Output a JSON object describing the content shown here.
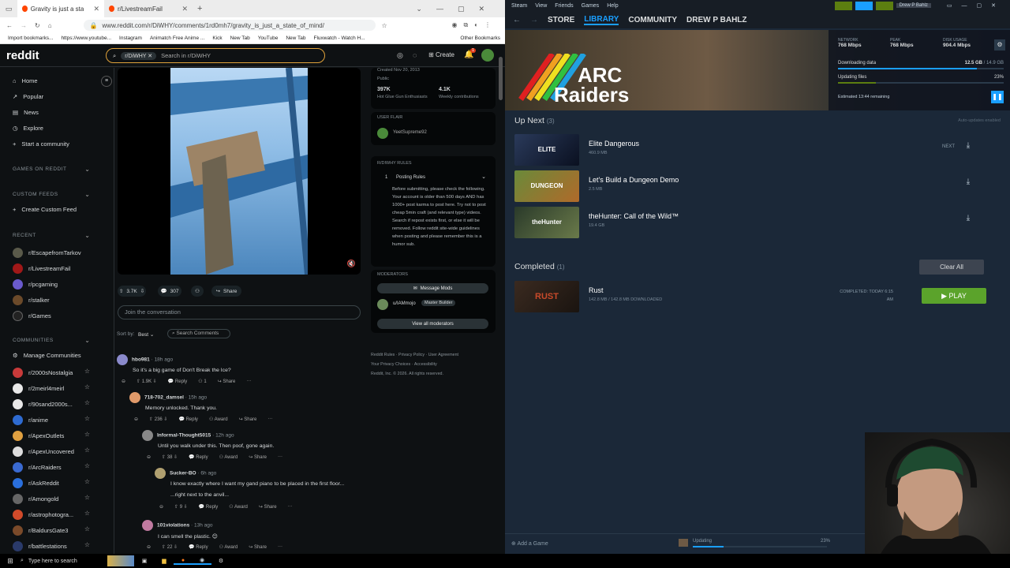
{
  "browser": {
    "tabs": [
      {
        "label": "Gravity is just a state of mind..."
      },
      {
        "label": "r/LivestreamFail"
      }
    ],
    "url": "www.reddit.com/r/DiWHY/comments/1rd0mh7/gravity_is_just_a_state_of_mind/",
    "bookmarks": [
      "Import bookmarks...",
      "https://www.youtube...",
      "Instagram",
      "Animatch Free Anime ...",
      "Kick",
      "New Tab",
      "YouTube",
      "New Tab",
      "Fluxwatch - Watch H...",
      "Other Bookmarks"
    ]
  },
  "reddit": {
    "logo": "reddit",
    "search_chip": "r/DiWHY",
    "search_placeholder": "Search in r/DiWHY",
    "create_label": "Create",
    "notif_count": "1",
    "sidebar": {
      "top": [
        {
          "label": "Home"
        },
        {
          "label": "Popular"
        },
        {
          "label": "News"
        },
        {
          "label": "Explore"
        },
        {
          "label": "Start a community"
        }
      ],
      "games_header": "GAMES ON REDDIT",
      "feeds_header": "CUSTOM FEEDS",
      "create_feed": "Create Custom Feed",
      "recent_header": "RECENT",
      "recent": [
        {
          "label": "r/EscapefromTarkov",
          "color": "#5a5a4a"
        },
        {
          "label": "r/LivestreamFail",
          "color": "#a01818"
        },
        {
          "label": "r/pcgaming",
          "color": "#6a5acd"
        },
        {
          "label": "r/stalker",
          "color": "#6b4a2a"
        },
        {
          "label": "r/Games",
          "color": "#222222"
        }
      ],
      "communities_header": "COMMUNITIES",
      "manage": "Manage Communities",
      "communities": [
        {
          "label": "r/2000sNostalgia",
          "color": "#c83a3a"
        },
        {
          "label": "r/2meirl4meirl",
          "color": "#e8e8e8"
        },
        {
          "label": "r/90sand2000s...",
          "color": "#e8e8e8"
        },
        {
          "label": "r/anime",
          "color": "#2e6bd1"
        },
        {
          "label": "r/ApexOutlets",
          "color": "#e0a040"
        },
        {
          "label": "r/ApexUncovered",
          "color": "#dddddd"
        },
        {
          "label": "r/ArcRaiders",
          "color": "#3a6ad1"
        },
        {
          "label": "r/AskReddit",
          "color": "#2a6fdc"
        },
        {
          "label": "r/Amongold",
          "color": "#666666"
        },
        {
          "label": "r/astrophotogra...",
          "color": "#d14a2a"
        },
        {
          "label": "r/BaldursGate3",
          "color": "#7a4a2a"
        },
        {
          "label": "r/battlestations",
          "color": "#2a3a6a"
        }
      ]
    },
    "post_actions": {
      "votes": "3.7K",
      "comments": "307",
      "share": "Share"
    },
    "join_placeholder": "Join the conversation",
    "sort_label": "Sort by:",
    "sort_value": "Best",
    "search_comments": "Search Comments",
    "comments": [
      {
        "user": "hbo981",
        "time": "18h ago",
        "text": "So it's a big game of Don't Break the Ice?",
        "votes": "1.9K",
        "reply": "Reply",
        "award": "1",
        "share": "Share"
      },
      {
        "user": "718-702_damsel",
        "time": "15h ago",
        "text": "Memory unlocked. Thank you.",
        "votes": "236",
        "reply": "Reply",
        "award": "Award",
        "share": "Share"
      },
      {
        "user": "Informal-Thought5015",
        "time": "12h ago",
        "text": "Until you walk under this. Then poof, gone again.",
        "votes": "38",
        "reply": "Reply",
        "award": "Award",
        "share": "Share"
      },
      {
        "user": "Sucker-BO",
        "time": "6h ago",
        "text": "I know exactly where I want my gand piano to be placed in the first floor...",
        "text2": "...right next to the anvil...",
        "votes": "9",
        "reply": "Reply",
        "award": "Award",
        "share": "Share"
      },
      {
        "user": "101violations",
        "time": "13h ago",
        "text": "I can smell the plastic. 😊",
        "votes": "22",
        "reply": "Reply",
        "award": "Award",
        "share": "Share"
      }
    ],
    "community_card": {
      "created": "Created Nov 20, 2013",
      "visibility": "Public",
      "members": "397K",
      "members_label": "Hot Glue Gun Enthusiasts",
      "weekly": "4.1K",
      "weekly_label": "Weekly contributions"
    },
    "user_flair_header": "USER FLAIR",
    "user_flair_name": "YeetSupreme92",
    "rules_header": "R/DIWHY RULES",
    "rule_num": "1",
    "rule_title": "Posting Rules",
    "rule_text": "Before submitting, please check the following. Your account is older than 500 days AND has 1000+ post karma to post here. Try not to post cheap 5min craft (and relevant type) videos. Search if repost exists first, or else it will be removed. Follow reddit site-wide guidelines when posting and please remember this is a humor sub.",
    "moderators_header": "MODERATORS",
    "message_mods": "Message Mods",
    "mod_name": "u/IAMmojo",
    "mod_flair": "Master Builder",
    "view_mods": "View all moderators",
    "footer_links": [
      "Reddit Rules",
      "Privacy Policy",
      "User Agreement",
      "Your Privacy Choices",
      "Accessibility"
    ],
    "copyright": "Reddit, Inc. © 2026. All rights reserved."
  },
  "steam": {
    "menu": [
      "Steam",
      "View",
      "Friends",
      "Games",
      "Help"
    ],
    "nav": [
      "STORE",
      "LIBRARY",
      "COMMUNITY",
      "DREW P BAHLZ"
    ],
    "user": "Drew P Bahlz",
    "banner_title_1": "ARC",
    "banner_title_2": "Raiders",
    "stats": [
      {
        "label": "NETWORK",
        "value": "768 Mbps"
      },
      {
        "label": "PEAK",
        "value": "768 Mbps"
      },
      {
        "label": "DISK USAGE",
        "value": "904.4 Mbps"
      }
    ],
    "downloading_label": "Downloading data",
    "downloading_value": "12.5 GB",
    "downloading_total": "/ 14.9 GB",
    "downloading_progress": 0.84,
    "updating_label": "Updating files",
    "updating_value": "23%",
    "updating_progress": 0.23,
    "eta": "Estimated 13:44 remaining",
    "up_next_title": "Up Next",
    "up_next_count": "(3)",
    "auto_updates": "Auto-updates enabled",
    "next_label": "NEXT",
    "queue": [
      {
        "title": "Elite Dangerous",
        "size": "460.9 MB",
        "thumb_text": "ELITE"
      },
      {
        "title": "Let's Build a Dungeon Demo",
        "size": "2.5 MB",
        "thumb_text": "DUNGEON"
      },
      {
        "title": "theHunter: Call of the Wild™",
        "size": "19.4 GB",
        "thumb_text": "theHunter"
      }
    ],
    "completed_title": "Completed",
    "completed_count": "(1)",
    "clear_all": "Clear All",
    "completed": {
      "title": "Rust",
      "size": "142.8 MB",
      "size_dl": "/ 142.8 MB DOWNLOADED",
      "status": "COMPLETED: TODAY 6:15",
      "status2": "AM",
      "play": "PLAY",
      "thumb_text": "RUST"
    },
    "add_game": "Add a Game",
    "footer_status": "Updating",
    "footer_pct": "23%",
    "footer_progress": 0.23
  },
  "taskbar": {
    "search_placeholder": "Type here to search"
  }
}
